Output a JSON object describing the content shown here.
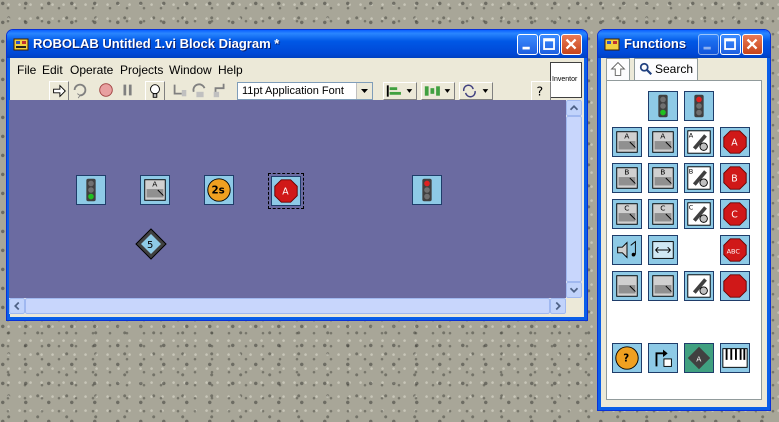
{
  "block_window": {
    "title": "ROBOLAB Untitled 1.vi Block Diagram *",
    "menus": [
      "File",
      "Edit",
      "Operate",
      "Projects",
      "Window",
      "Help"
    ],
    "font_selector": "11pt Application Font",
    "inventor_label": "Inventor",
    "nodes": [
      {
        "name": "begin-traffic-light-icon",
        "kind": "green-light"
      },
      {
        "name": "motor-a-icon",
        "kind": "motor",
        "letter": "A"
      },
      {
        "name": "wait-2s-icon",
        "kind": "wait",
        "label": "2s"
      },
      {
        "name": "stop-a-icon",
        "kind": "stop",
        "letter": "A"
      },
      {
        "name": "end-traffic-light-icon",
        "kind": "red-light"
      },
      {
        "name": "modifier-5-icon",
        "kind": "diamond",
        "label": "5"
      }
    ]
  },
  "functions_window": {
    "title": "Functions",
    "search_label": "Search",
    "palette_rows": [
      [
        {
          "k": "green-light"
        },
        {
          "k": "red-light"
        }
      ],
      [
        {
          "k": "motor",
          "l": "A"
        },
        {
          "k": "motor",
          "l": "A"
        },
        {
          "k": "motor-rev",
          "l": "A"
        },
        {
          "k": "stop",
          "l": "A"
        }
      ],
      [
        {
          "k": "motor",
          "l": "B"
        },
        {
          "k": "motor",
          "l": "B"
        },
        {
          "k": "motor-rev",
          "l": "B"
        },
        {
          "k": "stop",
          "l": "B"
        }
      ],
      [
        {
          "k": "motor",
          "l": "C"
        },
        {
          "k": "motor",
          "l": "C"
        },
        {
          "k": "motor-rev",
          "l": "C"
        },
        {
          "k": "stop",
          "l": "C"
        }
      ],
      [
        {
          "k": "sound"
        },
        {
          "k": "display"
        },
        {
          "k": "blank"
        },
        {
          "k": "stop",
          "l": "ABC"
        }
      ],
      [
        {
          "k": "motor",
          "l": ""
        },
        {
          "k": "motor",
          "l": ""
        },
        {
          "k": "motor-rev",
          "l": ""
        },
        {
          "k": "stop",
          "l": ""
        }
      ],
      [
        {
          "k": "wait",
          "l": "?"
        },
        {
          "k": "jump"
        },
        {
          "k": "modifier",
          "l": "A"
        },
        {
          "k": "music"
        }
      ]
    ]
  },
  "colors": {
    "titlebar": "#0058e6",
    "canvas": "#6b6ba1",
    "icon_bg": "#8ecae6",
    "stop_red": "#d01818"
  }
}
